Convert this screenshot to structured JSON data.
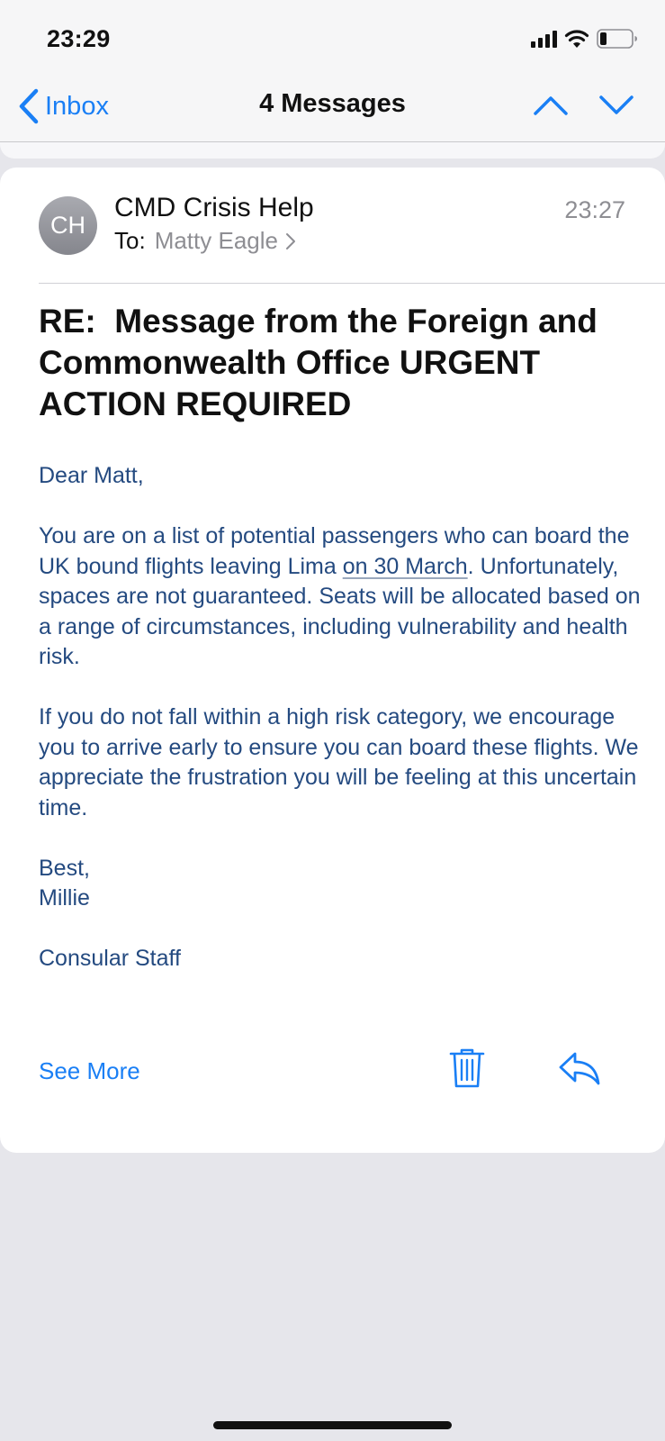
{
  "status_bar": {
    "time": "23:29"
  },
  "nav": {
    "back_label": "Inbox",
    "title": "4 Messages"
  },
  "email": {
    "avatar_initials": "CH",
    "sender": "CMD Crisis Help",
    "time": "23:27",
    "to_label": "To:",
    "to_name": "Matty Eagle",
    "subject": "RE:  Message from the Foreign and Commonwealth Office URGENT ACTION REQUIRED",
    "greeting": "Dear Matt,",
    "para1_before_link": "You are on a list of potential passengers who can board the UK bound flights leaving Lima ",
    "para1_link": "on 30 March",
    "para1_after_link": ". Unfortunately, spaces are not guaranteed. Seats will be allocated based on a range of circumstances, including vulnerability and health risk.",
    "para2": "If you do not fall within a high risk category, we encourage you to arrive early to ensure you can board these flights. We appreciate the frustration you will be feeling at this uncertain time.",
    "signoff": "Best,",
    "signer": "Millie",
    "signature": "Consular Staff"
  },
  "actions": {
    "see_more_label": "See More",
    "trash_icon": "trash-icon",
    "reply_icon": "reply-icon"
  },
  "colors": {
    "accent": "#1a7ff5",
    "body_text": "#244a80",
    "background": "#e6e6eb"
  }
}
